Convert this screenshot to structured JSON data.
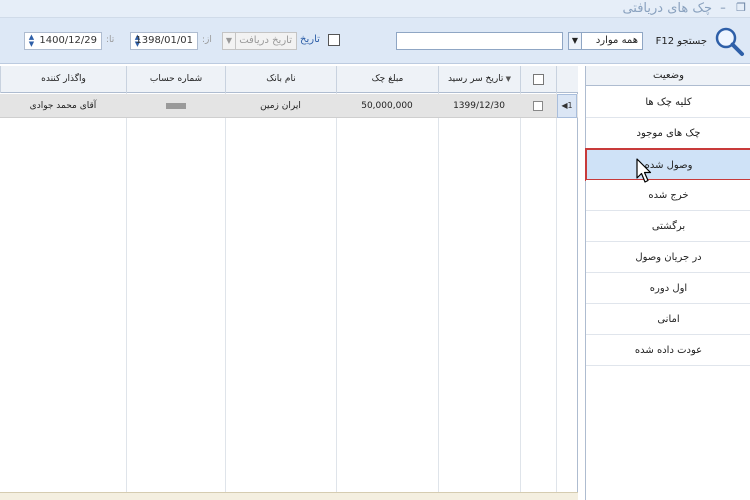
{
  "window": {
    "title": "چک های دریافتی",
    "minimize_glyph": "–",
    "restore_glyph": "❐"
  },
  "toolbar": {
    "search_label": "جستجو F12",
    "scope_value": "همه موارد",
    "search_value": "",
    "date_filter_label": "تاریخ",
    "date_type_value": "تاریخ دریافت",
    "from_label": "از:",
    "from_date": "1398/01/01",
    "to_label": "تا:",
    "to_date": "1400/12/29"
  },
  "grid": {
    "columns": {
      "due_date": "تاریخ سر رسید",
      "amount": "مبلغ چک",
      "bank": "نام بانک",
      "account": "شماره حساب",
      "assignor": "واگذار کننده"
    },
    "rows": [
      {
        "index": "1",
        "due_date": "1399/12/30",
        "amount": "50,000,000",
        "bank": "ایران زمین",
        "assignor": "آقای محمد جوادی"
      }
    ]
  },
  "panel": {
    "header": "وضعیت",
    "items": [
      "کلیه چک ها",
      "چک های موجود",
      "وصول شده",
      "خرج شده",
      "برگشتی",
      "در جریان وصول",
      "اول دوره",
      "امانی",
      "عودت داده شده"
    ],
    "selected_index": 2
  },
  "colors": {
    "toolbar_bg": "#dde8f6",
    "selected_bg": "#cfe2f7",
    "highlight_border": "#c83a3a",
    "accent_text": "#2e5fa8"
  }
}
